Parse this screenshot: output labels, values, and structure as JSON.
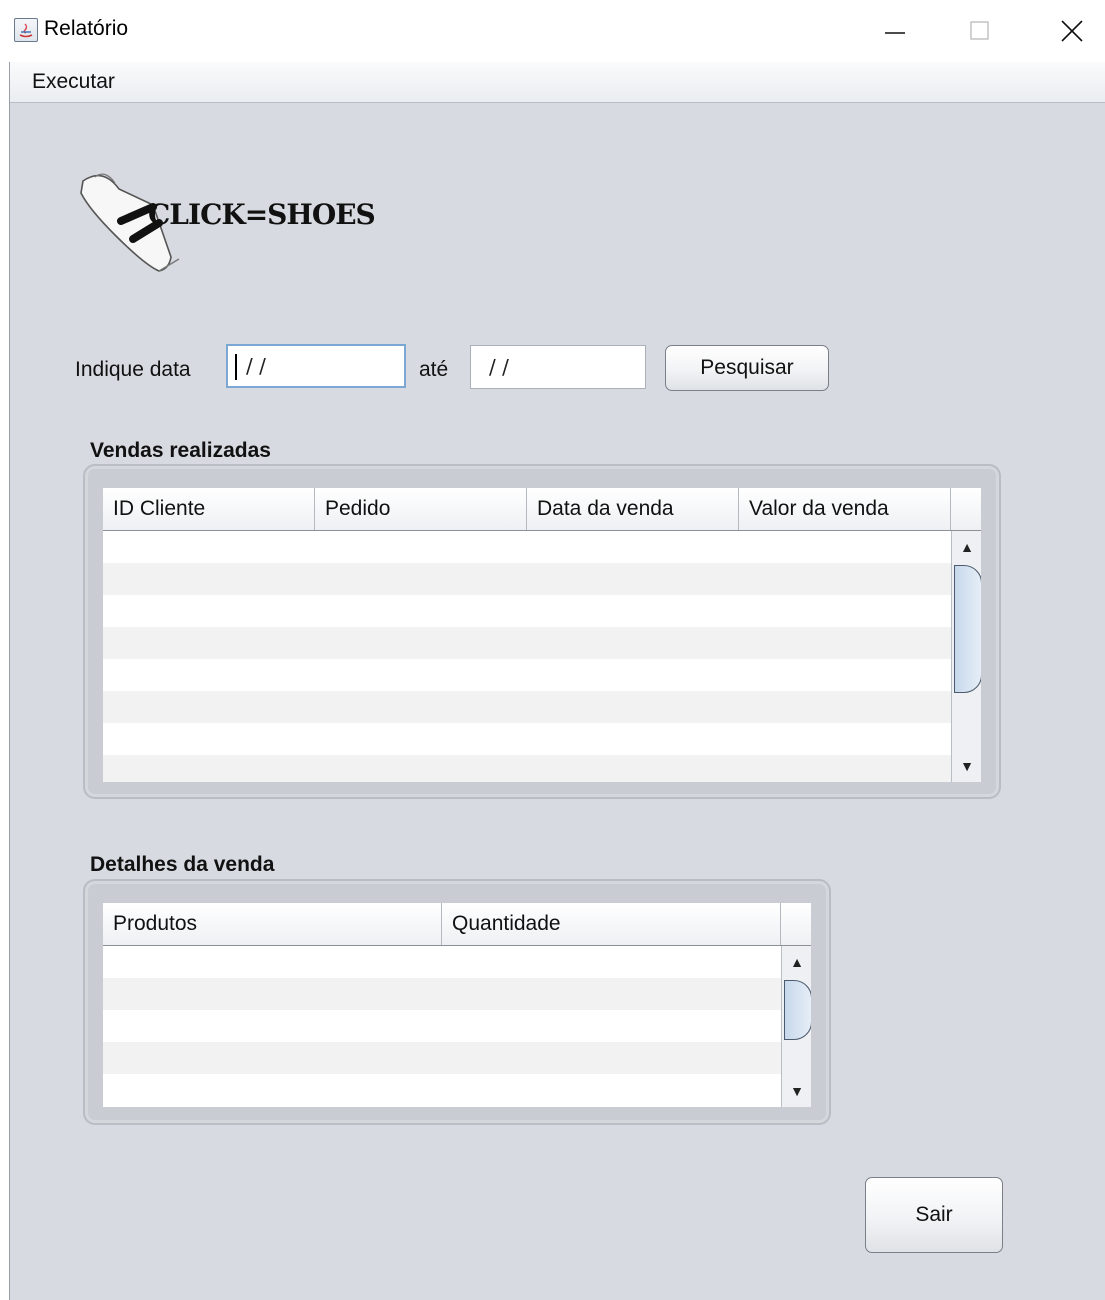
{
  "window": {
    "title": "Relatório"
  },
  "menubar": {
    "items": [
      "Executar"
    ]
  },
  "logo": {
    "text": "CLICK=SHOES"
  },
  "search": {
    "label_from": "Indique data",
    "from_value": "/ /",
    "label_to": "até",
    "to_value": "/ /",
    "button_label": "Pesquisar"
  },
  "sales": {
    "title": "Vendas realizadas",
    "columns": [
      "ID Cliente",
      "Pedido",
      "Data da venda",
      "Valor da venda"
    ]
  },
  "details": {
    "title": "Detalhes da venda",
    "columns": [
      "Produtos",
      "Quantidade"
    ]
  },
  "exit_button": {
    "label": "Sair"
  },
  "icons": {
    "app": "java-icon",
    "minimize": "minimize-icon",
    "maximize": "maximize-icon",
    "close": "close-icon",
    "scroll_up": "triangle-up-icon",
    "scroll_down": "triangle-down-icon"
  },
  "colors": {
    "window_bg": "#d7dae0",
    "panel_border": "#b9bdc4",
    "scroll_thumb": "#c7d8ec",
    "focus_border": "#7aa7d4"
  }
}
